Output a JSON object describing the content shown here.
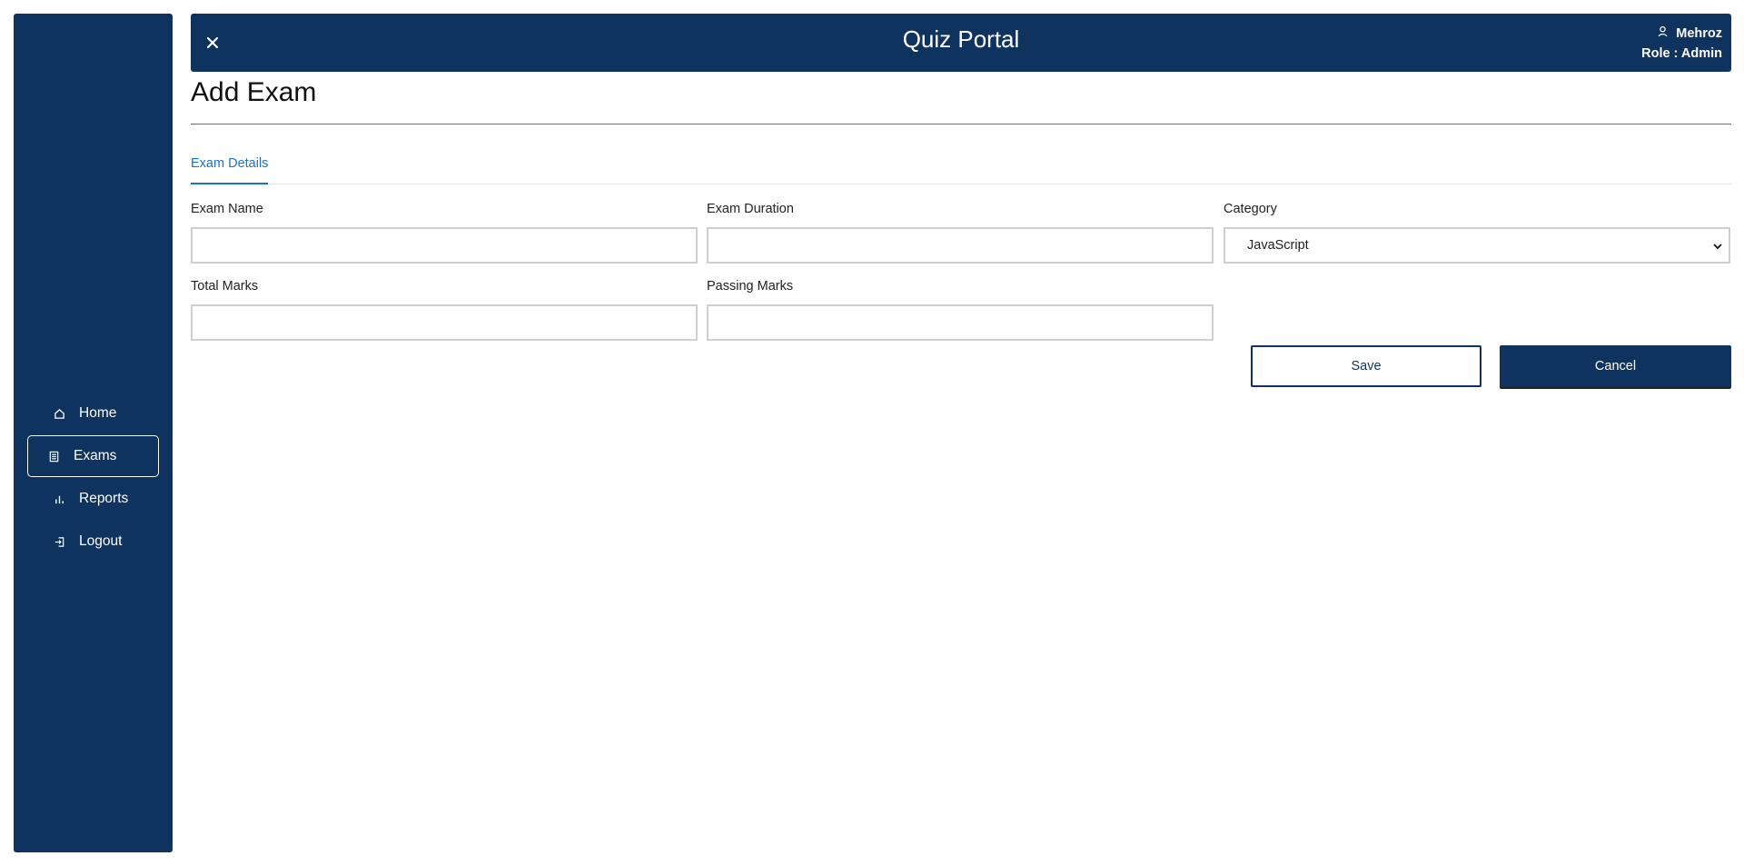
{
  "app": {
    "title": "Quiz Portal"
  },
  "user": {
    "name": "Mehroz",
    "role_text": "Role : Admin"
  },
  "sidebar": {
    "items": [
      {
        "label": "Home",
        "icon": "home-icon"
      },
      {
        "label": "Exams",
        "icon": "document-icon",
        "active": true
      },
      {
        "label": "Reports",
        "icon": "bar-chart-icon"
      },
      {
        "label": "Logout",
        "icon": "logout-icon"
      }
    ]
  },
  "page": {
    "title": "Add Exam"
  },
  "tabs": [
    {
      "label": "Exam Details",
      "active": true
    }
  ],
  "form": {
    "exam_name": {
      "label": "Exam Name",
      "value": ""
    },
    "exam_duration": {
      "label": "Exam Duration",
      "value": ""
    },
    "category": {
      "label": "Category",
      "selected": "JavaScript"
    },
    "total_marks": {
      "label": "Total Marks",
      "value": ""
    },
    "passing_marks": {
      "label": "Passing Marks",
      "value": ""
    }
  },
  "actions": {
    "save_label": "Save",
    "cancel_label": "Cancel"
  },
  "colors": {
    "primary": "#0f335f",
    "tab_active": "#1a73c8",
    "input_border": "#cfcfcf"
  }
}
